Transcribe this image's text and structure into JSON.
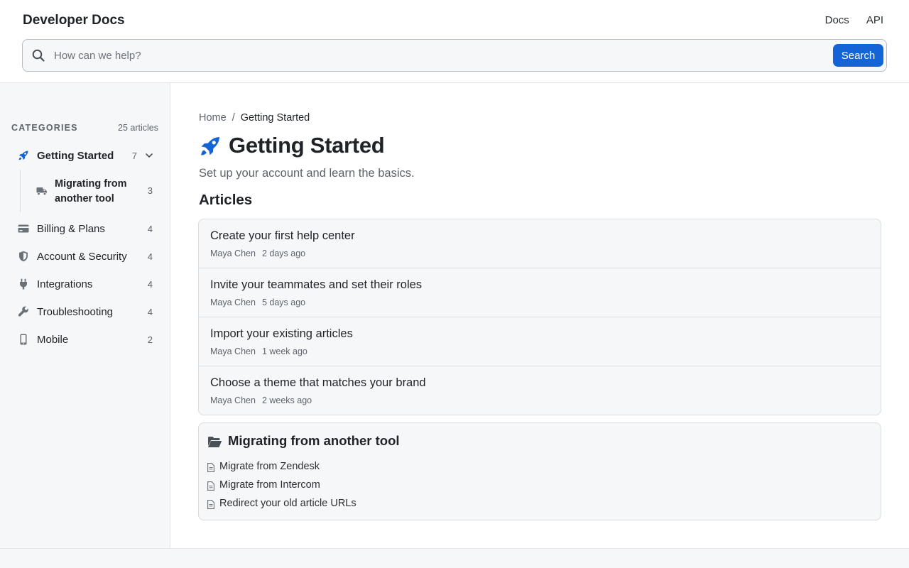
{
  "header": {
    "brand": "Developer Docs",
    "nav": [
      "Docs",
      "API"
    ],
    "search": {
      "placeholder": "How can we help?",
      "value": "",
      "button_label": "Search"
    },
    "accent_color": "#1364d6"
  },
  "sidebar": {
    "title": "CATEGORIES",
    "count": "25 articles",
    "items": [
      {
        "label": "Getting Started",
        "count": "7",
        "icon": "rocket-icon",
        "active": true,
        "expanded": true
      },
      {
        "label": "Billing & Plans",
        "count": "4",
        "icon": "credit-card-icon"
      },
      {
        "label": "Account & Security",
        "count": "4",
        "icon": "shield-icon"
      },
      {
        "label": "Integrations",
        "count": "4",
        "icon": "plug-icon"
      },
      {
        "label": "Troubleshooting",
        "count": "4",
        "icon": "wrench-icon"
      },
      {
        "label": "Mobile",
        "count": "2",
        "icon": "mobile-icon"
      }
    ],
    "subitems": [
      {
        "label": "Migrating from another tool",
        "count": "3",
        "icon": "truck-icon"
      }
    ]
  },
  "main": {
    "breadcrumb": {
      "home": "Home",
      "separator": "/",
      "current": "Getting Started"
    },
    "title": "Getting Started",
    "description": "Set up your account and learn the basics.",
    "articles_heading": "Articles",
    "articles": [
      {
        "title": "Create your first help center",
        "author": "Maya Chen",
        "time": "2 days ago"
      },
      {
        "title": "Invite your teammates and set their roles",
        "author": "Maya Chen",
        "time": "5 days ago"
      },
      {
        "title": "Import your existing articles",
        "author": "Maya Chen",
        "time": "1 week ago"
      },
      {
        "title": "Choose a theme that matches your brand",
        "author": "Maya Chen",
        "time": "2 weeks ago"
      }
    ],
    "subsection": {
      "title": "Migrating from another tool",
      "icon": "folder-open-icon",
      "links": [
        "Migrate from Zendesk",
        "Migrate from Intercom",
        "Redirect your old article URLs"
      ]
    }
  }
}
